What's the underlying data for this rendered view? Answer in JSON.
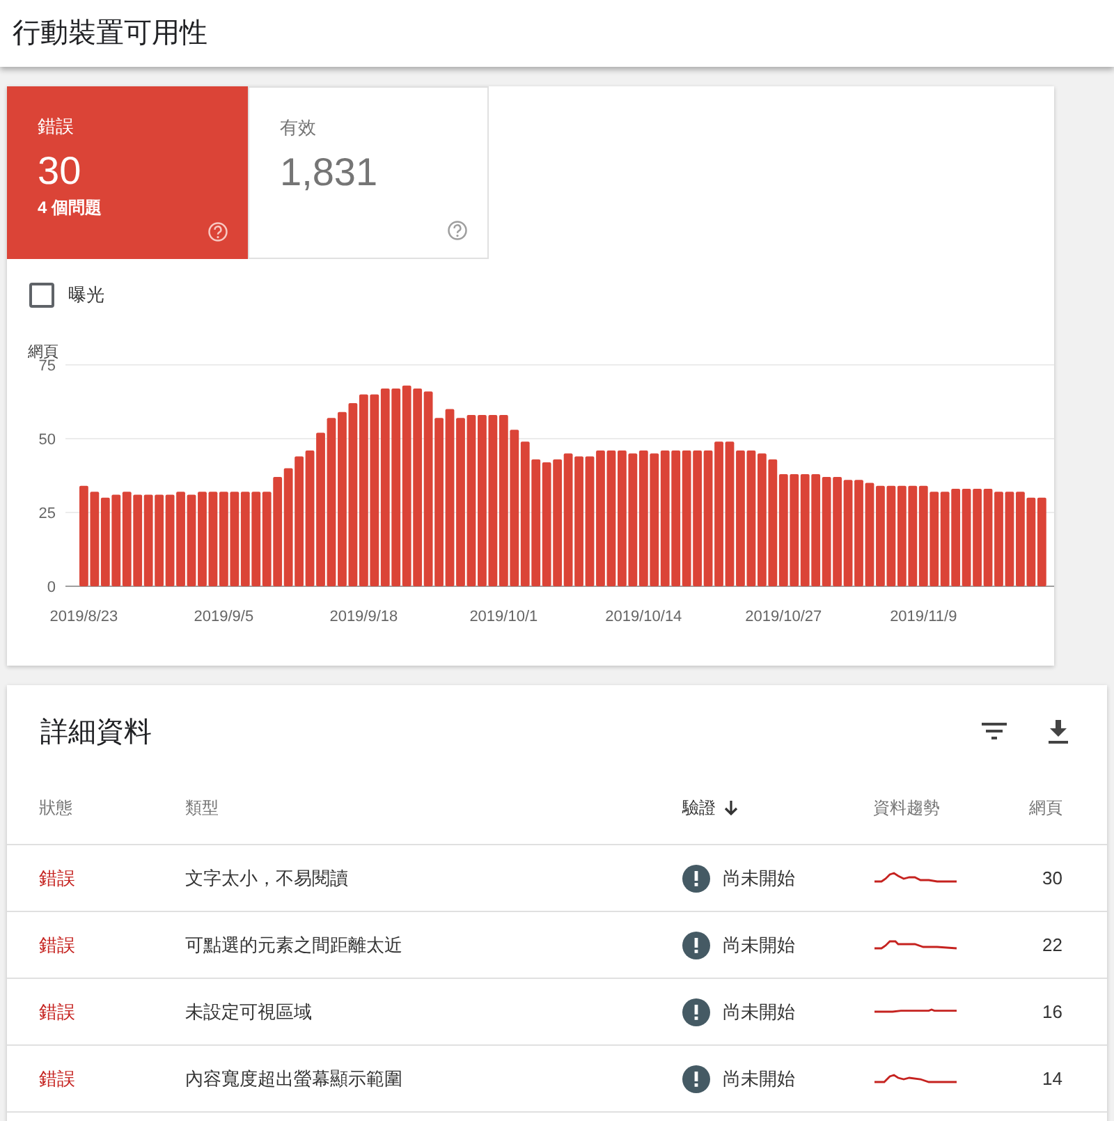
{
  "page_title": "行動裝置可用性",
  "summary_cards": [
    {
      "label": "錯誤",
      "value": "30",
      "subtitle": "4 個問題",
      "selected": true
    },
    {
      "label": "有效",
      "value": "1,831",
      "selected": false
    }
  ],
  "impressions_checkbox": {
    "label": "曝光",
    "checked": false
  },
  "chart": {
    "chart_data": {
      "type": "bar",
      "ylabel": "網頁",
      "ylim": [
        0,
        75
      ],
      "yticks": [
        0,
        25,
        50,
        75
      ],
      "categories": [
        "2019/8/23",
        null,
        null,
        null,
        null,
        null,
        null,
        null,
        null,
        null,
        null,
        null,
        null,
        "2019/9/5",
        null,
        null,
        null,
        null,
        null,
        null,
        null,
        null,
        null,
        null,
        null,
        null,
        "2019/9/18",
        null,
        null,
        null,
        null,
        null,
        null,
        null,
        null,
        null,
        null,
        null,
        null,
        "2019/10/1",
        null,
        null,
        null,
        null,
        null,
        null,
        null,
        null,
        null,
        null,
        null,
        null,
        "2019/10/14",
        null,
        null,
        null,
        null,
        null,
        null,
        null,
        null,
        null,
        null,
        null,
        null,
        "2019/10/27",
        null,
        null,
        null,
        null,
        null,
        null,
        null,
        null,
        null,
        null,
        null,
        null,
        "2019/11/9",
        null,
        null,
        null,
        null,
        null,
        null,
        null,
        null,
        null,
        null,
        null
      ],
      "series": [
        {
          "color": "#db4437",
          "values": [
            34,
            32,
            30,
            31,
            32,
            31,
            31,
            31,
            31,
            32,
            31,
            32,
            32,
            32,
            32,
            32,
            32,
            32,
            37,
            40,
            44,
            46,
            52,
            57,
            59,
            62,
            65,
            65,
            67,
            67,
            68,
            67,
            66,
            57,
            60,
            57,
            58,
            58,
            58,
            58,
            53,
            49,
            43,
            42,
            43,
            45,
            44,
            44,
            46,
            46,
            46,
            45,
            46,
            45,
            46,
            46,
            46,
            46,
            46,
            49,
            49,
            46,
            46,
            45,
            43,
            38,
            38,
            38,
            38,
            37,
            37,
            36,
            36,
            35,
            34,
            34,
            34,
            34,
            34,
            32,
            32,
            33,
            33,
            33,
            33,
            32,
            32,
            32,
            30,
            30
          ]
        }
      ]
    }
  },
  "details": {
    "title": "詳細資料",
    "columns": [
      {
        "label": "狀態",
        "sorted": false
      },
      {
        "label": "類型",
        "sorted": false
      },
      {
        "label": "驗證",
        "sorted": true
      },
      {
        "label": "資料趨勢",
        "sorted": false
      },
      {
        "label": "網頁",
        "sorted": false
      }
    ],
    "rows": [
      {
        "status": "錯誤",
        "type": "文字太小，不易閱讀",
        "validation": "尚未開始",
        "pages": "30"
      },
      {
        "status": "錯誤",
        "type": "可點選的元素之間距離太近",
        "validation": "尚未開始",
        "pages": "22"
      },
      {
        "status": "錯誤",
        "type": "未設定可視區域",
        "validation": "尚未開始",
        "pages": "16"
      },
      {
        "status": "錯誤",
        "type": "內容寬度超出螢幕顯示範圍",
        "validation": "尚未開始",
        "pages": "14"
      }
    ]
  }
}
